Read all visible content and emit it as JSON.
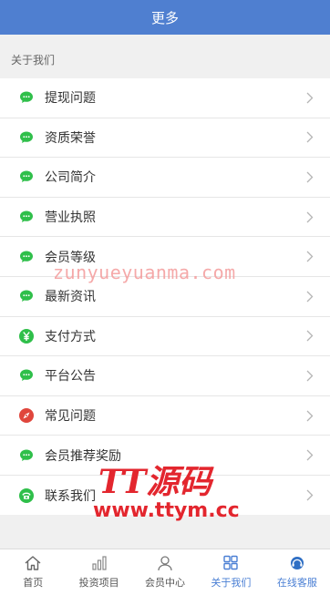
{
  "header": {
    "title": "更多"
  },
  "section": {
    "title": "关于我们"
  },
  "menu": {
    "items": [
      {
        "label": "提现问题",
        "icon": "chat-icon"
      },
      {
        "label": "资质荣誉",
        "icon": "chat-icon"
      },
      {
        "label": "公司简介",
        "icon": "chat-icon"
      },
      {
        "label": "营业执照",
        "icon": "chat-icon"
      },
      {
        "label": "会员等级",
        "icon": "chat-icon"
      },
      {
        "label": "最新资讯",
        "icon": "chat-icon"
      },
      {
        "label": "支付方式",
        "icon": "yen-icon"
      },
      {
        "label": "平台公告",
        "icon": "chat-icon"
      },
      {
        "label": "常见问题",
        "icon": "compass-icon"
      },
      {
        "label": "会员推荐奖励",
        "icon": "chat-icon"
      },
      {
        "label": "联系我们",
        "icon": "phone-icon"
      }
    ]
  },
  "tabbar": {
    "tabs": [
      {
        "label": "首页",
        "icon": "home-icon",
        "active": false
      },
      {
        "label": "投资项目",
        "icon": "bar-chart-icon",
        "active": false
      },
      {
        "label": "会员中心",
        "icon": "user-icon",
        "active": false
      },
      {
        "label": "关于我们",
        "icon": "grid-icon",
        "active": true
      },
      {
        "label": "在线客服",
        "icon": "headset-icon",
        "active": true
      }
    ]
  },
  "watermarks": {
    "url_text": "zunyueyuanma.com",
    "logo_line1": "TT源码",
    "logo_line2": "www.ttym.cc"
  },
  "colors": {
    "header_bg": "#4f7fd0",
    "chat_icon": "#2fbf4a",
    "compass_icon": "#e0463c",
    "active_tab": "#4a7fd4"
  }
}
